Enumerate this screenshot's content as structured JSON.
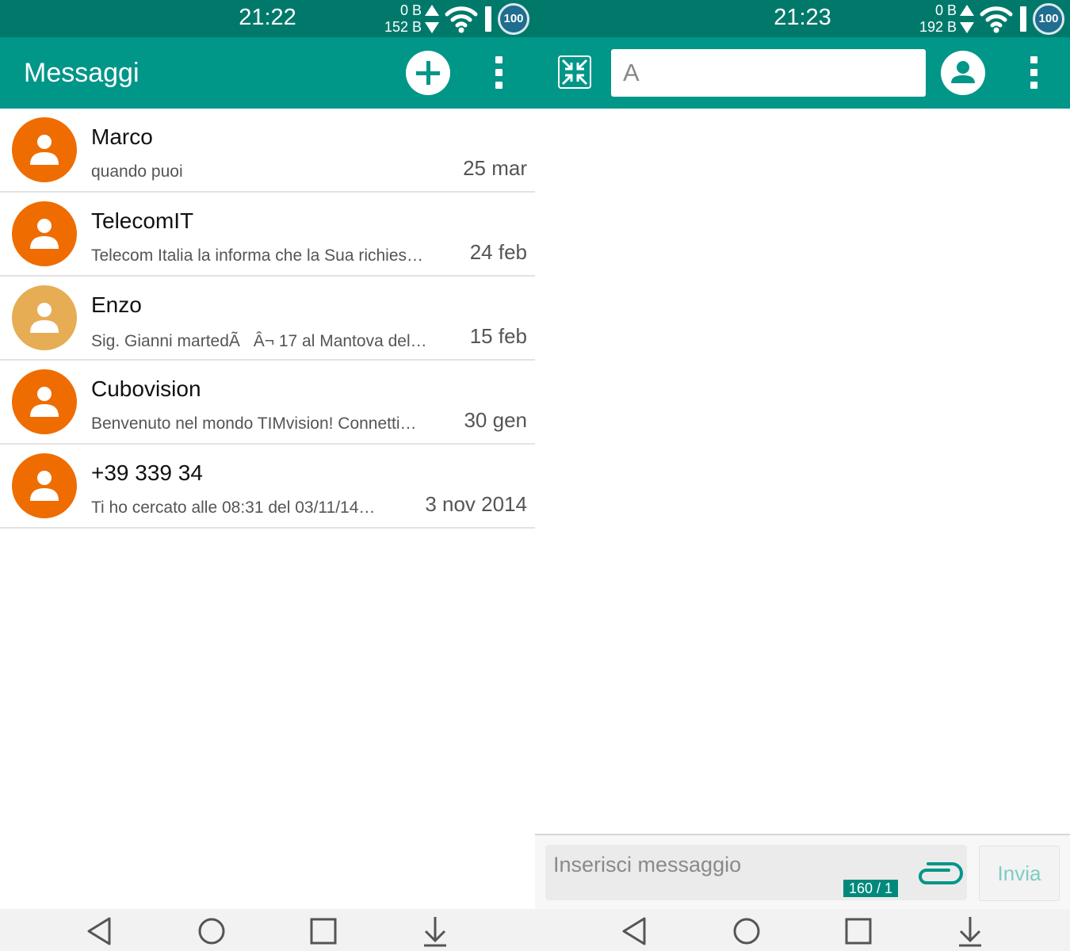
{
  "colors": {
    "status_bar": "#00796b",
    "toolbar": "#009688",
    "accent": "#009688",
    "avatar_default": "#ef6c00",
    "avatar_alt": "#e6ad55",
    "send_disabled": "#80cbc4",
    "counter_badge": "#00897b"
  },
  "left_screen": {
    "status_bar": {
      "time": "21:22",
      "upload": "0 B",
      "download": "152 B",
      "battery": "100",
      "icons": [
        "up-arrow-icon",
        "down-arrow-icon",
        "wifi-icon",
        "signal-icon",
        "battery-icon"
      ]
    },
    "toolbar": {
      "title": "Messaggi",
      "icons": [
        "add-icon",
        "more-options-icon"
      ]
    },
    "conversations": [
      {
        "name": "Marco",
        "preview": "quando puoi",
        "date": "25 mar",
        "avatar_color": "#ef6c00"
      },
      {
        "name": "TelecomIT",
        "preview": "Telecom Italia la informa che la Sua richies…",
        "date": "24 feb",
        "avatar_color": "#ef6c00"
      },
      {
        "name": "Enzo",
        "preview": "Sig. Gianni martedÃÂ¬ 17 al Mantova del…",
        "date": "15 feb",
        "avatar_color": "#e6ad55"
      },
      {
        "name": "Cubovision",
        "preview": "Benvenuto nel mondo TIMvision! Connetti…",
        "date": "30 gen",
        "avatar_color": "#ef6c00"
      },
      {
        "name": "+39 339 34",
        "preview": "Ti ho cercato alle 08:31 del 03/11/14…",
        "date": "3 nov 2014",
        "avatar_color": "#ef6c00"
      }
    ],
    "nav_bar": {
      "icons": [
        "back-icon",
        "home-icon",
        "recents-icon",
        "notifications-icon"
      ]
    }
  },
  "right_screen": {
    "status_bar": {
      "time": "21:23",
      "upload": "0 B",
      "download": "192 B",
      "battery": "100"
    },
    "toolbar": {
      "recipient_value": "A",
      "icons": [
        "compress-icon",
        "contact-icon",
        "more-options-icon"
      ]
    },
    "composer": {
      "placeholder": "Inserisci messaggio",
      "counter": "160 / 1",
      "send_label": "Invia",
      "icons": [
        "attach-icon"
      ]
    },
    "nav_bar": {
      "icons": [
        "back-icon",
        "home-icon",
        "recents-icon",
        "notifications-icon"
      ]
    }
  }
}
